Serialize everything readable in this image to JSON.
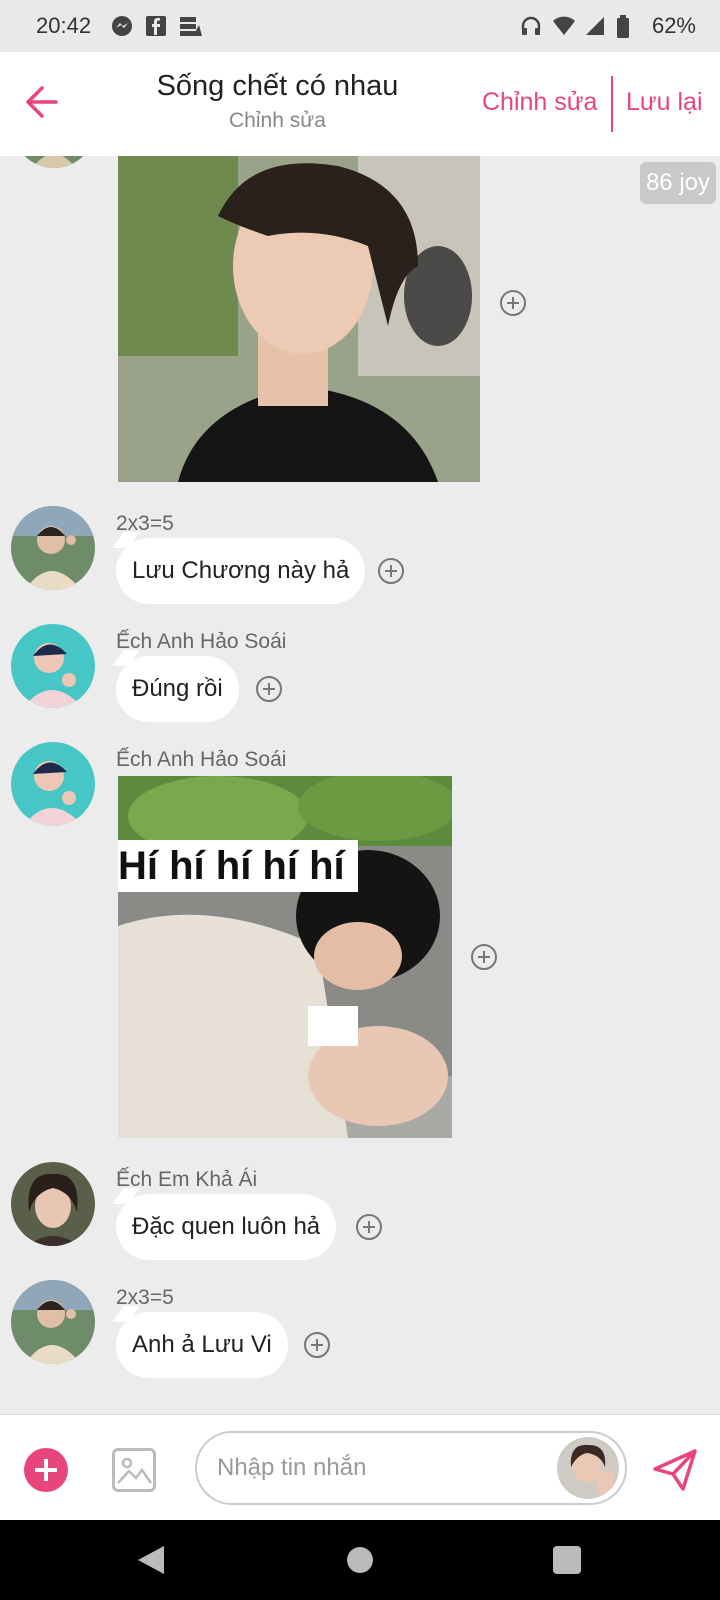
{
  "status_bar": {
    "time": "20:42",
    "left_icons": [
      "messenger-icon",
      "facebook-icon",
      "storage-icon"
    ],
    "right_icons": [
      "headphones-icon",
      "wifi-icon",
      "signal-icon",
      "battery-icon"
    ],
    "battery": "62%"
  },
  "header": {
    "back_icon": "arrow-left-icon",
    "title": "Sống chết có nhau",
    "subtitle": "Chỉnh sửa",
    "edit_label": "Chỉnh sửa",
    "save_label": "Lưu lại",
    "accent_color": "#e8457f"
  },
  "chat": {
    "joy_badge": "86 joy",
    "messages": [
      {
        "sender": "",
        "type": "image",
        "overlay_text": ""
      },
      {
        "sender": "2x3=5",
        "type": "text",
        "text": "Lưu Chương này hả"
      },
      {
        "sender": "Ếch Anh Hảo Soái",
        "type": "text",
        "text": "Đúng rồi"
      },
      {
        "sender": "Ếch Anh Hảo Soái",
        "type": "image",
        "overlay_text": "Hí hí hí hí hí"
      },
      {
        "sender": "Ếch Em Khả Ái",
        "type": "text",
        "text": "Đặc quen luôn hả"
      },
      {
        "sender": "2x3=5",
        "type": "text",
        "text": "Anh ả Lưu Vi"
      }
    ]
  },
  "input_bar": {
    "placeholder": "Nhập tin nhắn",
    "add_icon": "plus-circle-icon",
    "image_icon": "image-icon",
    "send_icon": "send-icon"
  },
  "nav_bar": {
    "icons": [
      "back-triangle-icon",
      "home-circle-icon",
      "recents-square-icon"
    ]
  }
}
